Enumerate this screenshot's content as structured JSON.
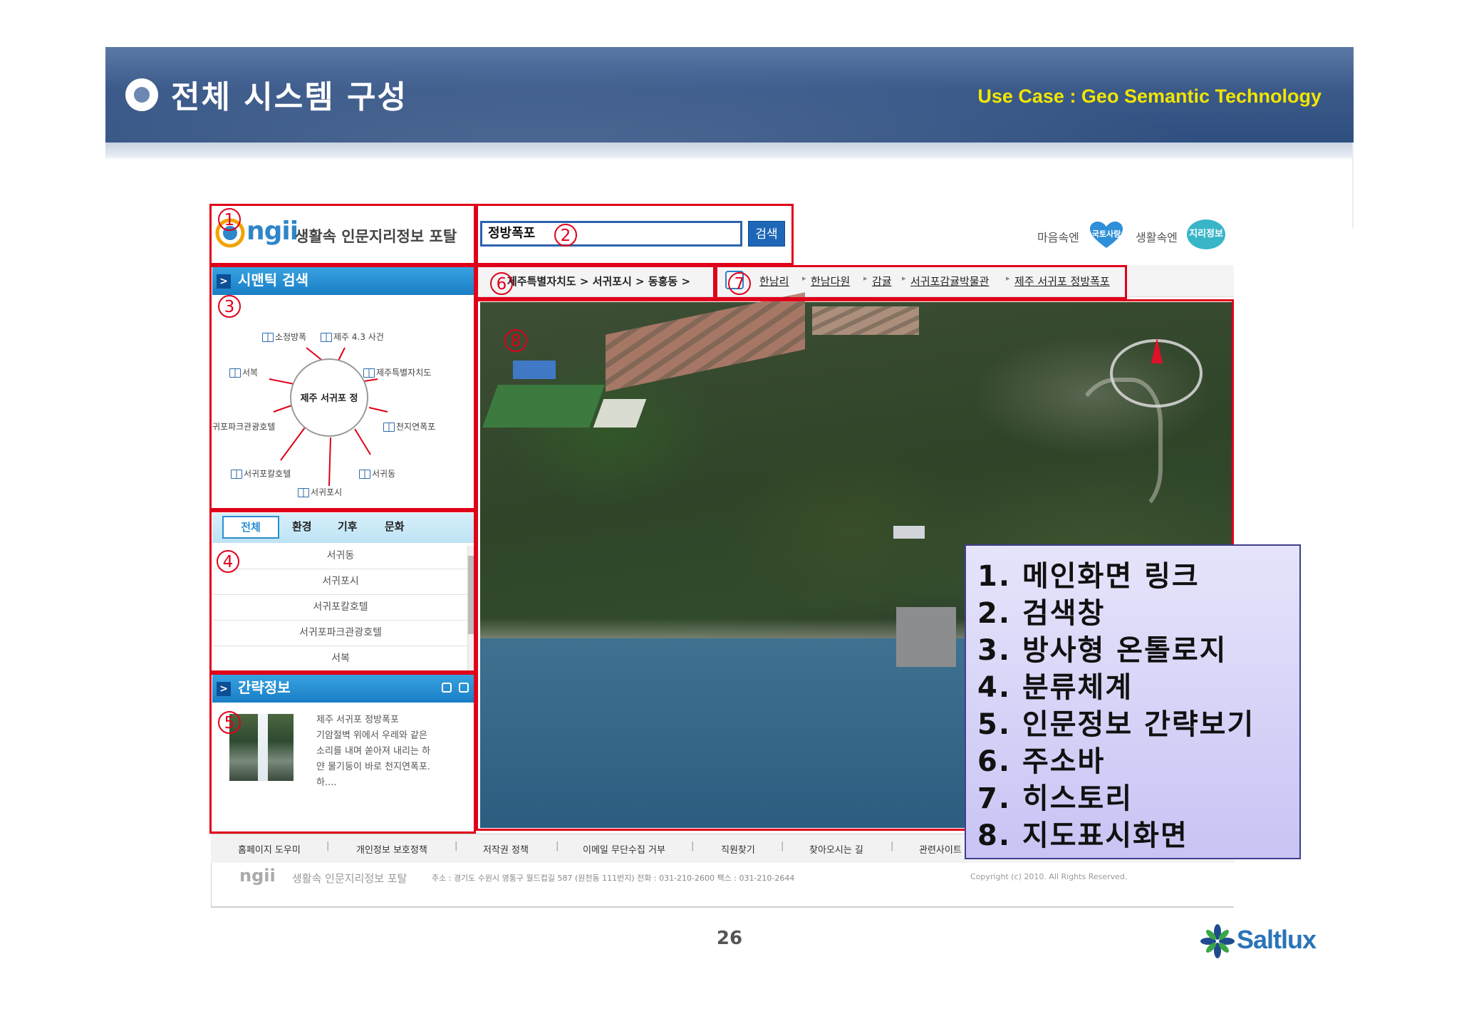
{
  "slide": {
    "title": "전체 시스템 구성",
    "subtitle": "Use Case : Geo Semantic Technology",
    "page_number": "26",
    "brand": "Saltlux"
  },
  "portal": {
    "logo_word": "ngii",
    "logo_tagline": "생활속 인문지리정보 포탈",
    "search": {
      "value": "정방폭포",
      "button": "검색"
    },
    "slogans": {
      "left": "마음속엔",
      "heart_badge": "국토사랑",
      "right": "생활속엔",
      "bubble_badge": "지리정보"
    },
    "semantic_search": {
      "title": "시맨틱 검색",
      "center": "제주 서귀포 정",
      "nodes": [
        "소정방폭",
        "제주 4.3 사건",
        "서복",
        "제주특별자치도",
        "귀포파크관광호텔",
        "천지연폭포",
        "서귀포칼호텔",
        "서귀동",
        "서귀포시"
      ]
    },
    "categories": {
      "tabs": [
        "전체",
        "환경",
        "기후",
        "문화"
      ],
      "items": [
        "서귀동",
        "서귀포시",
        "서귀포칼호텔",
        "서귀포파크관광호텔",
        "서복"
      ]
    },
    "brief": {
      "title": "간략정보",
      "lines": [
        "제주 서귀포 정방폭포",
        "기암절벽 위에서 우레와 같은",
        "소리를 내며 쏟아져 내리는 하",
        "얀 물기둥이 바로 천지연폭포.",
        "하...."
      ]
    },
    "address": "제주특별자치도 > 서귀포시 > 동홍동 >",
    "history": [
      "한남리",
      "한남다원",
      "감귤",
      "서귀포감귤박물관",
      "제주 서귀포 정방폭포"
    ],
    "footer": {
      "links": [
        "홈페이지 도우미",
        "개인정보 보호정책",
        "저작권 정책",
        "이메일 무단수집 거부",
        "직원찾기",
        "찾아오시는 길",
        "관련사이트"
      ],
      "logo": "ngii",
      "portal": "생활속 인문지리정보 포탈",
      "address": "주소 : 경기도 수원시 영통구 월드컵길 587 (원천동 111번지)   전화 : 031-210-2600   팩스 : 031-210-2644",
      "copyright": "Copyright (c) 2010. All Rights Reserved."
    }
  },
  "markers": [
    "1",
    "2",
    "3",
    "4",
    "5",
    "6",
    "7",
    "8"
  ],
  "legend": [
    "1.  메인화면 링크",
    "2.  검색창",
    "3.  방사형 온톨로지",
    "4.  분류체계",
    "5.  인문정보 간략보기",
    "6.  주소바",
    "7.  히스토리",
    "8.  지도표시화면"
  ],
  "colors": {
    "header": "#3b5a8a",
    "subtitle": "#f2e500",
    "highlight": "#e0001a",
    "portal_blue": "#1a7ec6",
    "legend_bg": "#d6d3f7"
  }
}
